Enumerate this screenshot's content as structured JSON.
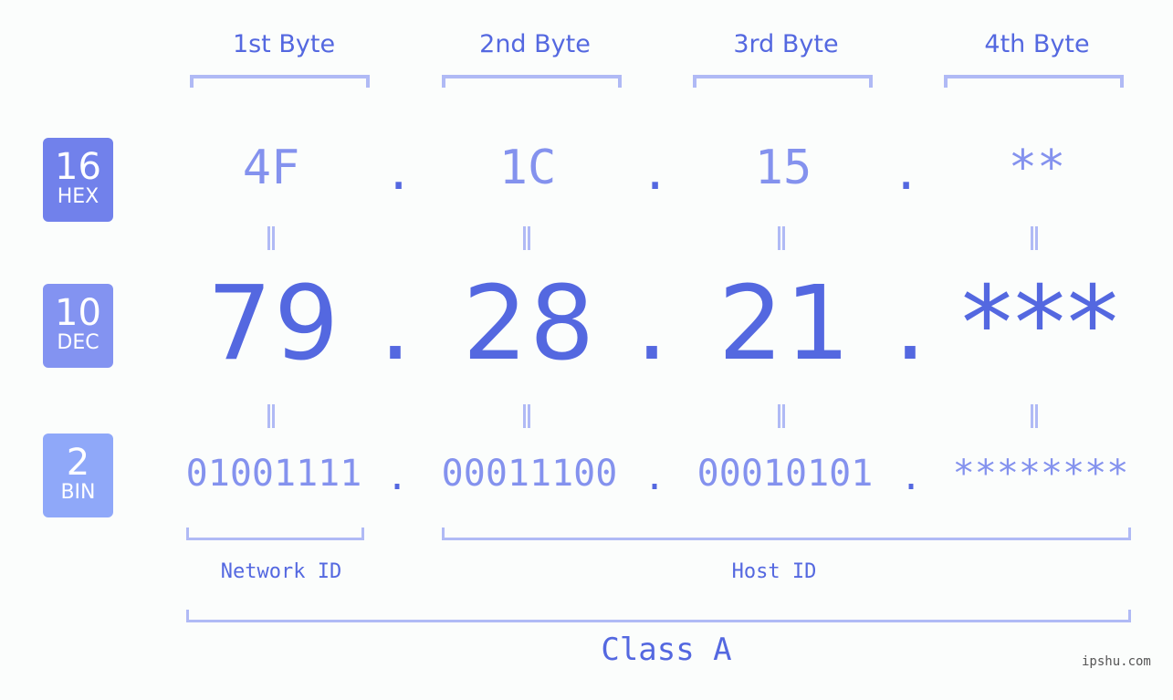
{
  "bytes": {
    "labels": [
      "1st Byte",
      "2nd Byte",
      "3rd Byte",
      "4th Byte"
    ]
  },
  "badges": {
    "hex": {
      "num": "16",
      "label": "HEX",
      "color": "#7181eb"
    },
    "dec": {
      "num": "10",
      "label": "DEC",
      "color": "#8393f1"
    },
    "bin": {
      "num": "2",
      "label": "BIN",
      "color": "#8fa8f9"
    }
  },
  "rows": {
    "hex": [
      "4F",
      "1C",
      "15",
      "**"
    ],
    "dec": [
      "79",
      "28",
      "21",
      "***"
    ],
    "bin": [
      "01001111",
      "00011100",
      "00010101",
      "********"
    ],
    "separator": "."
  },
  "segments": {
    "network_id": "Network ID",
    "host_id": "Host ID",
    "class": "Class A"
  },
  "watermark": "ipshu.com",
  "colors": {
    "accent": "#5468e0",
    "light": "#8492ee",
    "bracket": "#b0baf5"
  }
}
